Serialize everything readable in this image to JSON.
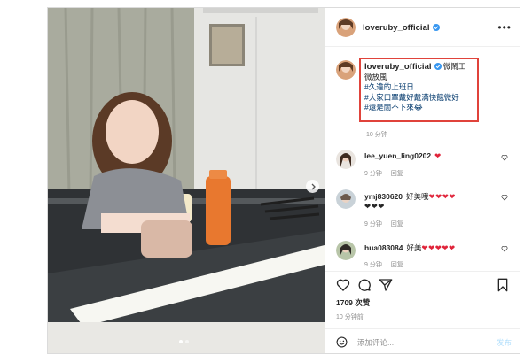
{
  "post": {
    "username": "loveruby_official",
    "more_label": "•••",
    "caption_lines": [
      {
        "text": "微鬧工",
        "tag": false
      },
      {
        "text": "微放風",
        "tag": false
      },
      {
        "text": "#久違的上班日",
        "tag": true
      },
      {
        "text": "#大家口罩戴好戴滿快餓微好",
        "tag": true
      },
      {
        "text": "#還是閒不下來😂",
        "tag": true
      }
    ],
    "caption_time": "10 分钟",
    "comments": [
      {
        "user": "lee_yuen_ling0202",
        "text": "",
        "hearts": "❤",
        "time": "9 分钟",
        "reply": "回复"
      },
      {
        "user": "ymj830620",
        "text": "好美哦",
        "hearts": "❤❤❤❤❤❤❤",
        "time": "9 分钟",
        "reply": "回复"
      },
      {
        "user": "hua083084",
        "text": "好美",
        "hearts": "❤❤❤❤❤",
        "time": "9 分钟",
        "reply": "回复"
      }
    ],
    "likes": "1709 次赞",
    "post_time": "10 分钟前",
    "add_comment_placeholder": "添加评论...",
    "post_button": "发布"
  },
  "carousel": {
    "count": 2,
    "active": 0
  },
  "colors": {
    "highlight_box": "#e0433b",
    "verified": "#3897f0",
    "heart": "#e0243a",
    "link": "#00376b"
  },
  "icons": [
    "more-icon",
    "verified-icon",
    "heart-icon",
    "comment-icon",
    "share-icon",
    "bookmark-icon",
    "emoji-icon",
    "next-arrow-icon"
  ]
}
